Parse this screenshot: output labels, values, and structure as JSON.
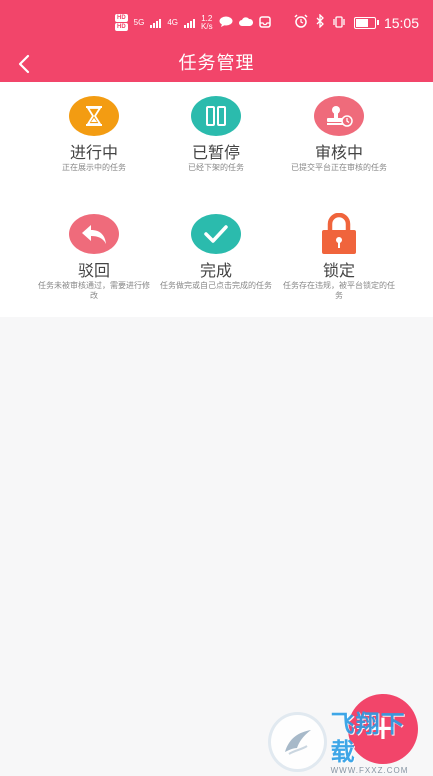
{
  "status_bar": {
    "network_1": "HD",
    "network_2": "HD",
    "signal_1": "5G",
    "signal_2": "4G",
    "speed_value": "1.2",
    "speed_unit": "K/s",
    "time": "15:05",
    "battery_level": 0.7
  },
  "nav": {
    "title": "任务管理"
  },
  "tiles": [
    {
      "label": "进行中",
      "desc": "正在展示中的任务",
      "icon": "hourglass-icon",
      "color": "#f39c12"
    },
    {
      "label": "已暂停",
      "desc": "已经下架的任务",
      "icon": "pause-icon",
      "color": "#2bbbad"
    },
    {
      "label": "审核中",
      "desc": "已提交平台正在审核的任务",
      "icon": "stamp-icon",
      "color": "#ef6b7b"
    },
    {
      "label": "驳回",
      "desc": "任务未被审核通过，需要进行修改",
      "icon": "reply-arrow-icon",
      "color": "#ef6b7b"
    },
    {
      "label": "完成",
      "desc": "任务做完或自己点击完成的任务",
      "icon": "checkmark-icon",
      "color": "#2bbbad"
    },
    {
      "label": "锁定",
      "desc": "任务存在违规，被平台锁定的任务",
      "icon": "lock-icon",
      "color": "#f0643c"
    }
  ],
  "fab": {
    "label": "+"
  },
  "watermark": {
    "main": "飞翔下载",
    "url": "WWW.FXXZ.COM"
  }
}
